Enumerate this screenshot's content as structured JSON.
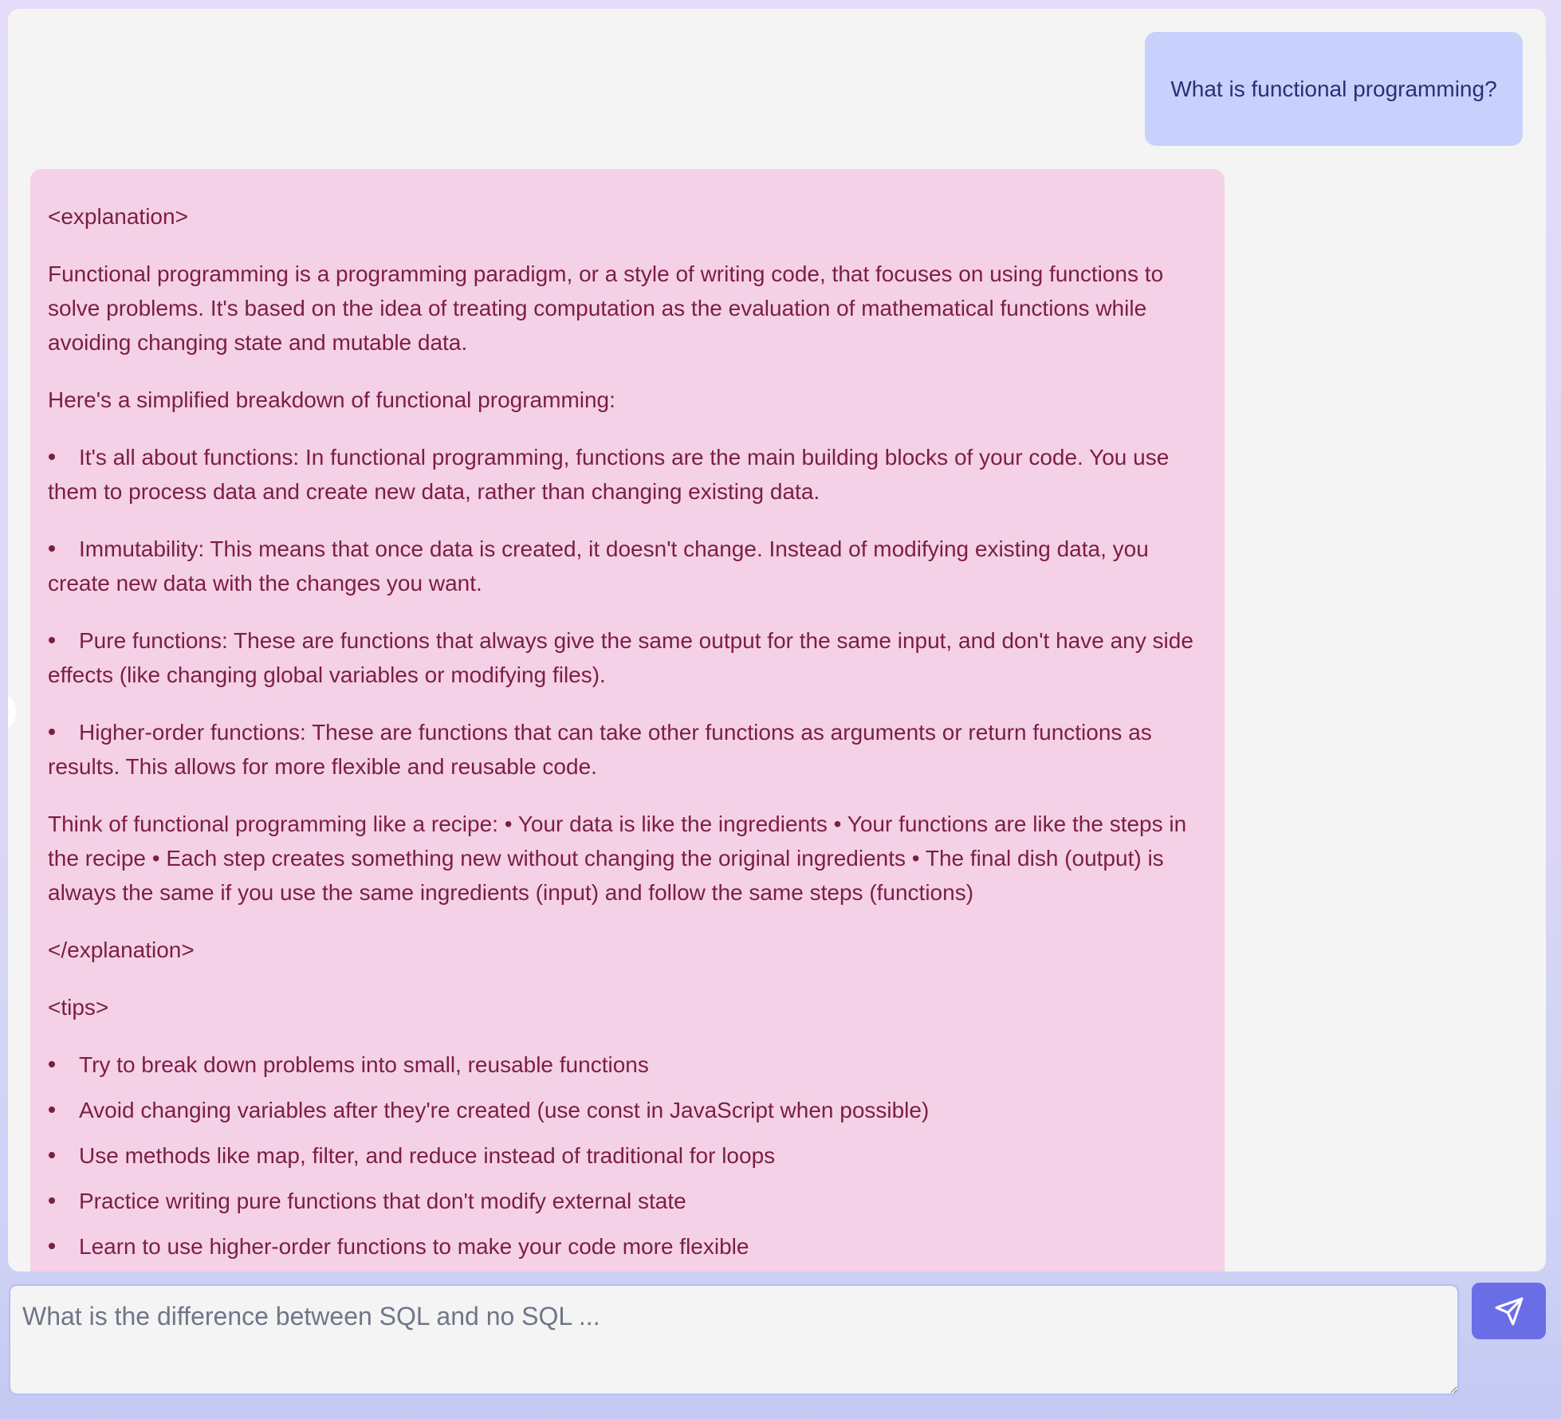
{
  "chat": {
    "user_message": "What is functional programming?",
    "assistant": {
      "explanation_open": "<explanation>",
      "intro_paragraph": "Functional programming is a programming paradigm, or a style of writing code, that focuses on using functions to solve problems. It's based on the idea of treating computation as the evaluation of mathematical functions while avoiding changing state and mutable data.",
      "breakdown_heading": "Here's a simplified breakdown of functional programming:",
      "points": [
        "It's all about functions: In functional programming, functions are the main building blocks of your code. You use them to process data and create new data, rather than changing existing data.",
        "Immutability: This means that once data is created, it doesn't change. Instead of modifying existing data, you create new data with the changes you want.",
        "Pure functions: These are functions that always give the same output for the same input, and don't have any side effects (like changing global variables or modifying files).",
        "Higher-order functions: These are functions that can take other functions as arguments or return functions as results. This allows for more flexible and reusable code."
      ],
      "recipe_paragraph": "Think of functional programming like a recipe: • Your data is like the ingredients • Your functions are like the steps in the recipe • Each step creates something new without changing the original ingredients • The final dish (output) is always the same if you use the same ingredients (input) and follow the same steps (functions)",
      "explanation_close": "</explanation>",
      "tips_open": "<tips>",
      "tips": [
        "Try to break down problems into small, reusable functions",
        "Avoid changing variables after they're created (use const in JavaScript when possible)",
        "Use methods like map, filter, and reduce instead of traditional for loops",
        "Practice writing pure functions that don't modify external state",
        "Learn to use higher-order functions to make your code more flexible"
      ]
    }
  },
  "composer": {
    "placeholder": "What is the difference between SQL and no SQL ...",
    "value": "",
    "send_icon": "paper-plane-icon"
  },
  "colors": {
    "user_bubble": "#c8d1fb",
    "assistant_bubble": "#f4d1e6",
    "assistant_text": "#7c1d47",
    "send_button": "#6a6ee6"
  }
}
